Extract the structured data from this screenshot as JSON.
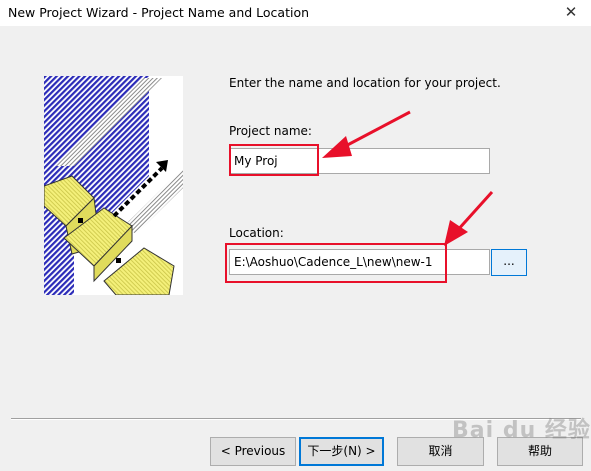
{
  "window": {
    "title": "New Project Wizard - Project Name and Location",
    "close_icon": "✕"
  },
  "intro_text": "Enter the name and location for your project.",
  "project_name": {
    "label": "Project name:",
    "value": "My Proj"
  },
  "location": {
    "label": "Location:",
    "value": "E:\\Aoshuo\\Cadence_L\\new\\new-1",
    "browse_label": "..."
  },
  "buttons": {
    "previous": "< Previous",
    "next": "下一步(N) >",
    "cancel": "取消",
    "help": "帮助"
  },
  "watermark": "Bai du 经验",
  "annotation_color": "#e8102a",
  "icons": [
    "wizard-illustration",
    "close-icon",
    "annotation-arrow"
  ]
}
